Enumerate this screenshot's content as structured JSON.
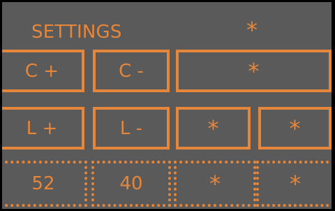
{
  "header": {
    "title": "SETTINGS",
    "star": "*"
  },
  "row1": {
    "c_plus": "C +",
    "c_minus": "C -",
    "wide": "*"
  },
  "row2": {
    "l_plus": "L +",
    "l_minus": "L -",
    "slot3": "*",
    "slot4": "*"
  },
  "values": {
    "c_value": "52",
    "l_value": "40",
    "slot3": "*",
    "slot4": "*"
  },
  "colors": {
    "background": "#5a5a5a",
    "accent": "#e6863a",
    "frame": "#000000"
  }
}
